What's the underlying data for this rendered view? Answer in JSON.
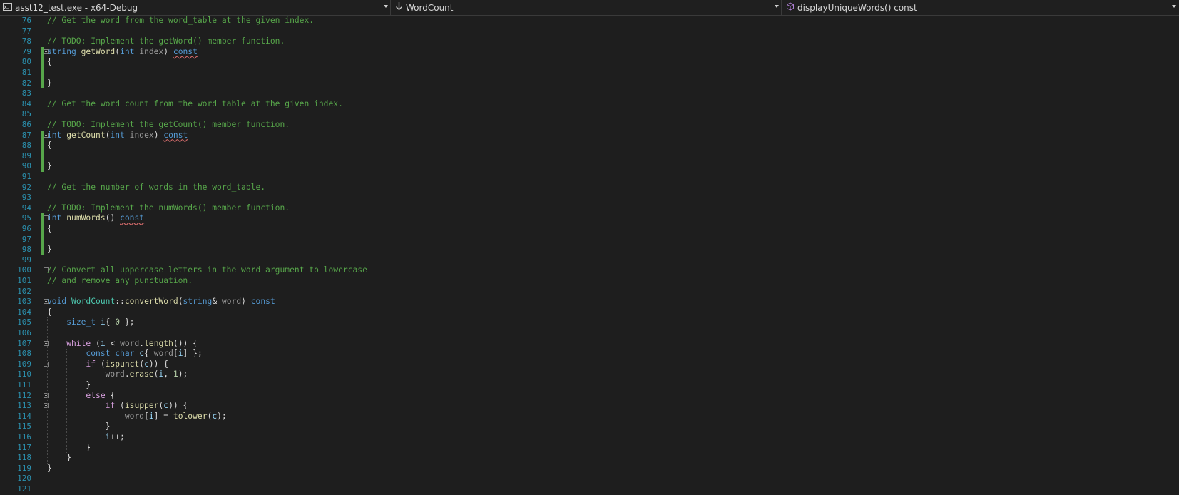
{
  "navbar": {
    "project": "asst12_test.exe - x64-Debug",
    "class": "WordCount",
    "member": "displayUniqueWords() const"
  },
  "lines": [
    {
      "n": "76",
      "change": false,
      "tokens": [
        [
          "cm",
          "// Get the word from the word_table at the given index."
        ]
      ]
    },
    {
      "n": "77",
      "change": false,
      "tokens": []
    },
    {
      "n": "78",
      "change": false,
      "tokens": [
        [
          "cm",
          "// TODO: Implement the getWord() member function."
        ]
      ]
    },
    {
      "n": "79",
      "change": true,
      "fold": true,
      "tokens": [
        [
          "kw",
          "string"
        ],
        [
          "pl",
          " "
        ],
        [
          "fn",
          "getWord"
        ],
        [
          "pl",
          "("
        ],
        [
          "kw",
          "int"
        ],
        [
          "pl",
          " "
        ],
        [
          "par",
          "index"
        ],
        [
          "pl",
          ") "
        ],
        [
          "kw",
          "const"
        ]
      ]
    },
    {
      "n": "80",
      "change": true,
      "tokens": [
        [
          "pl",
          "{"
        ]
      ]
    },
    {
      "n": "81",
      "change": true,
      "tokens": []
    },
    {
      "n": "82",
      "change": true,
      "tokens": [
        [
          "pl",
          "}"
        ]
      ]
    },
    {
      "n": "83",
      "change": false,
      "tokens": []
    },
    {
      "n": "84",
      "change": false,
      "tokens": [
        [
          "cm",
          "// Get the word count from the word_table at the given index."
        ]
      ]
    },
    {
      "n": "85",
      "change": false,
      "tokens": []
    },
    {
      "n": "86",
      "change": false,
      "tokens": [
        [
          "cm",
          "// TODO: Implement the getCount() member function."
        ]
      ]
    },
    {
      "n": "87",
      "change": true,
      "fold": true,
      "tokens": [
        [
          "kw",
          "int"
        ],
        [
          "pl",
          " "
        ],
        [
          "fn",
          "getCount"
        ],
        [
          "pl",
          "("
        ],
        [
          "kw",
          "int"
        ],
        [
          "pl",
          " "
        ],
        [
          "par",
          "index"
        ],
        [
          "pl",
          ") "
        ],
        [
          "kw",
          "const"
        ]
      ]
    },
    {
      "n": "88",
      "change": true,
      "tokens": [
        [
          "pl",
          "{"
        ]
      ]
    },
    {
      "n": "89",
      "change": true,
      "tokens": []
    },
    {
      "n": "90",
      "change": true,
      "tokens": [
        [
          "pl",
          "}"
        ]
      ]
    },
    {
      "n": "91",
      "change": false,
      "tokens": []
    },
    {
      "n": "92",
      "change": false,
      "tokens": [
        [
          "cm",
          "// Get the number of words in the word_table."
        ]
      ]
    },
    {
      "n": "93",
      "change": false,
      "tokens": []
    },
    {
      "n": "94",
      "change": false,
      "tokens": [
        [
          "cm",
          "// TODO: Implement the numWords() member function."
        ]
      ]
    },
    {
      "n": "95",
      "change": true,
      "fold": true,
      "tokens": [
        [
          "kw",
          "int"
        ],
        [
          "pl",
          " "
        ],
        [
          "fn",
          "numWords"
        ],
        [
          "pl",
          "() "
        ],
        [
          "kw",
          "const"
        ]
      ]
    },
    {
      "n": "96",
      "change": true,
      "tokens": [
        [
          "pl",
          "{"
        ]
      ]
    },
    {
      "n": "97",
      "change": true,
      "tokens": []
    },
    {
      "n": "98",
      "change": true,
      "tokens": [
        [
          "pl",
          "}"
        ]
      ]
    },
    {
      "n": "99",
      "change": false,
      "tokens": []
    },
    {
      "n": "100",
      "change": false,
      "fold": true,
      "tokens": [
        [
          "cm",
          "// Convert all uppercase letters in the word argument to lowercase"
        ]
      ]
    },
    {
      "n": "101",
      "change": false,
      "tokens": [
        [
          "cm",
          "// and remove any punctuation."
        ]
      ]
    },
    {
      "n": "102",
      "change": false,
      "tokens": []
    },
    {
      "n": "103",
      "change": false,
      "fold": true,
      "tokens": [
        [
          "kw",
          "void"
        ],
        [
          "pl",
          " "
        ],
        [
          "ty",
          "WordCount"
        ],
        [
          "pl",
          "::"
        ],
        [
          "fn",
          "convertWord"
        ],
        [
          "pl",
          "("
        ],
        [
          "kw",
          "string"
        ],
        [
          "pl",
          "& "
        ],
        [
          "par",
          "word"
        ],
        [
          "pl",
          ") "
        ],
        [
          "kw",
          "const"
        ]
      ]
    },
    {
      "n": "104",
      "change": false,
      "tokens": [
        [
          "pl",
          "{"
        ]
      ]
    },
    {
      "n": "105",
      "change": false,
      "tokens": [
        [
          "pl",
          "    "
        ],
        [
          "kw",
          "size_t"
        ],
        [
          "pl",
          " "
        ],
        [
          "var",
          "i"
        ],
        [
          "pl",
          "{ "
        ],
        [
          "num",
          "0"
        ],
        [
          "pl",
          " };"
        ]
      ]
    },
    {
      "n": "106",
      "change": false,
      "tokens": []
    },
    {
      "n": "107",
      "change": false,
      "fold": true,
      "tokens": [
        [
          "pl",
          "    "
        ],
        [
          "ctl",
          "while"
        ],
        [
          "pl",
          " ("
        ],
        [
          "var",
          "i"
        ],
        [
          "pl",
          " < "
        ],
        [
          "par",
          "word"
        ],
        [
          "pl",
          "."
        ],
        [
          "fn",
          "length"
        ],
        [
          "pl",
          "()) {"
        ]
      ]
    },
    {
      "n": "108",
      "change": false,
      "tokens": [
        [
          "pl",
          "        "
        ],
        [
          "kw",
          "const"
        ],
        [
          "pl",
          " "
        ],
        [
          "kw",
          "char"
        ],
        [
          "pl",
          " "
        ],
        [
          "var",
          "c"
        ],
        [
          "pl",
          "{ "
        ],
        [
          "par",
          "word"
        ],
        [
          "pl",
          "["
        ],
        [
          "var",
          "i"
        ],
        [
          "pl",
          "] };"
        ]
      ]
    },
    {
      "n": "109",
      "change": false,
      "fold": true,
      "tokens": [
        [
          "pl",
          "        "
        ],
        [
          "ctl",
          "if"
        ],
        [
          "pl",
          " ("
        ],
        [
          "fn",
          "ispunct"
        ],
        [
          "pl",
          "("
        ],
        [
          "var",
          "c"
        ],
        [
          "pl",
          ")) {"
        ]
      ]
    },
    {
      "n": "110",
      "change": false,
      "tokens": [
        [
          "pl",
          "            "
        ],
        [
          "par",
          "word"
        ],
        [
          "pl",
          "."
        ],
        [
          "fn",
          "erase"
        ],
        [
          "pl",
          "("
        ],
        [
          "var",
          "i"
        ],
        [
          "pl",
          ", "
        ],
        [
          "num",
          "1"
        ],
        [
          "pl",
          ");"
        ]
      ]
    },
    {
      "n": "111",
      "change": false,
      "tokens": [
        [
          "pl",
          "        }"
        ]
      ]
    },
    {
      "n": "112",
      "change": false,
      "fold": true,
      "tokens": [
        [
          "pl",
          "        "
        ],
        [
          "ctl",
          "else"
        ],
        [
          "pl",
          " {"
        ]
      ]
    },
    {
      "n": "113",
      "change": false,
      "fold": true,
      "tokens": [
        [
          "pl",
          "            "
        ],
        [
          "ctl",
          "if"
        ],
        [
          "pl",
          " ("
        ],
        [
          "fn",
          "isupper"
        ],
        [
          "pl",
          "("
        ],
        [
          "var",
          "c"
        ],
        [
          "pl",
          ")) {"
        ]
      ]
    },
    {
      "n": "114",
      "change": false,
      "tokens": [
        [
          "pl",
          "                "
        ],
        [
          "par",
          "word"
        ],
        [
          "pl",
          "["
        ],
        [
          "var",
          "i"
        ],
        [
          "pl",
          "] = "
        ],
        [
          "fn",
          "tolower"
        ],
        [
          "pl",
          "("
        ],
        [
          "var",
          "c"
        ],
        [
          "pl",
          ");"
        ]
      ]
    },
    {
      "n": "115",
      "change": false,
      "tokens": [
        [
          "pl",
          "            }"
        ]
      ]
    },
    {
      "n": "116",
      "change": false,
      "tokens": [
        [
          "pl",
          "            "
        ],
        [
          "var",
          "i"
        ],
        [
          "pl",
          "++;"
        ]
      ]
    },
    {
      "n": "117",
      "change": false,
      "tokens": [
        [
          "pl",
          "        }"
        ]
      ]
    },
    {
      "n": "118",
      "change": false,
      "tokens": [
        [
          "pl",
          "    }"
        ]
      ]
    },
    {
      "n": "119",
      "change": false,
      "tokens": [
        [
          "pl",
          "}"
        ]
      ]
    },
    {
      "n": "120",
      "change": false,
      "tokens": []
    },
    {
      "n": "121",
      "change": false,
      "tokens": []
    }
  ],
  "colors": {
    "background": "#1e1e1e",
    "line_number": "#2b91af",
    "comment": "#57a64a",
    "keyword": "#569cd6",
    "control": "#d8a0df",
    "type": "#4ec9b0",
    "function": "#dcdcaa",
    "variable": "#9cdcfe",
    "parameter": "#9a9a9a",
    "number": "#b5cea8",
    "change_bar": "#57a64a"
  }
}
